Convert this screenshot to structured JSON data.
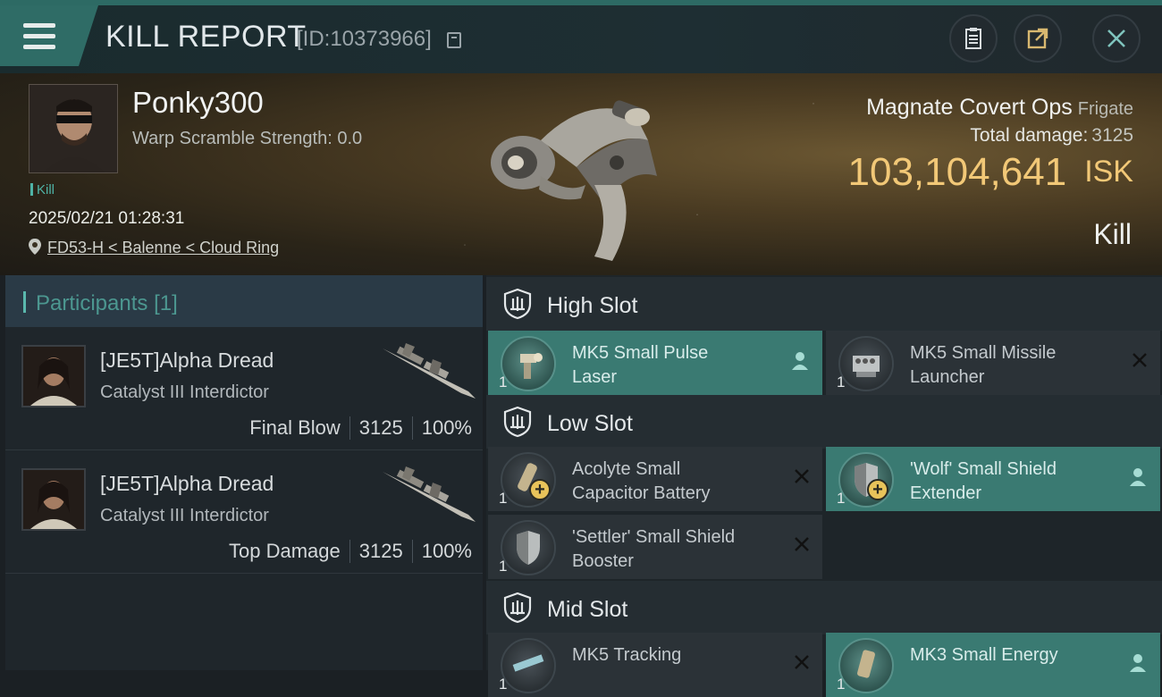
{
  "header": {
    "title": "KILL REPORT",
    "report_id": "[ID:10373966]",
    "buttons": [
      "clipboard-icon",
      "export-icon",
      "close-icon"
    ]
  },
  "victim": {
    "pilot_name": "Ponky300",
    "warp_scramble": "Warp Scramble Strength: 0.0",
    "tag": "Kill",
    "datetime": "2025/02/21 01:28:31",
    "location": "FD53-H < Balenne < Cloud Ring",
    "ship_name": "Magnate Covert Ops",
    "ship_class": "Frigate",
    "total_damage_label": "Total damage:",
    "total_damage_value": "3125",
    "isk_value": "103,104,641",
    "isk_unit": "ISK",
    "result": "Kill"
  },
  "participants": {
    "title": "Participants",
    "count": "[1]",
    "rows": [
      {
        "name": "[JE5T]Alpha Dread",
        "ship": "Catalyst III Interdictor",
        "label": "Final Blow",
        "damage": "3125",
        "percent": "100%"
      },
      {
        "name": "[JE5T]Alpha Dread",
        "ship": "Catalyst III Interdictor",
        "label": "Top Damage",
        "damage": "3125",
        "percent": "100%"
      }
    ]
  },
  "slots": {
    "high": {
      "label": "High Slot",
      "items": [
        {
          "line1": "MK5 Small Pulse",
          "line2": "Laser",
          "qty": "1",
          "state": "person"
        },
        {
          "line1": "MK5 Small Missile",
          "line2": "Launcher",
          "qty": "1",
          "state": "x"
        }
      ]
    },
    "low": {
      "label": "Low Slot",
      "items": [
        {
          "line1": "Acolyte Small",
          "line2": "Capacitor Battery",
          "qty": "1",
          "state": "x"
        },
        {
          "line1": "'Wolf' Small Shield",
          "line2": "Extender",
          "qty": "1",
          "state": "person"
        },
        {
          "line1": "'Settler' Small Shield",
          "line2": "Booster",
          "qty": "1",
          "state": "x"
        }
      ]
    },
    "mid": {
      "label": "Mid Slot",
      "items": [
        {
          "line1": "MK5 Tracking",
          "line2": "",
          "qty": "1",
          "state": "x"
        },
        {
          "line1": "MK3 Small Energy",
          "line2": "",
          "qty": "1",
          "state": "person"
        }
      ]
    }
  },
  "colors": {
    "accent": "#3a7a72",
    "isk": "#f2c877",
    "teal_text": "#4c9790"
  }
}
